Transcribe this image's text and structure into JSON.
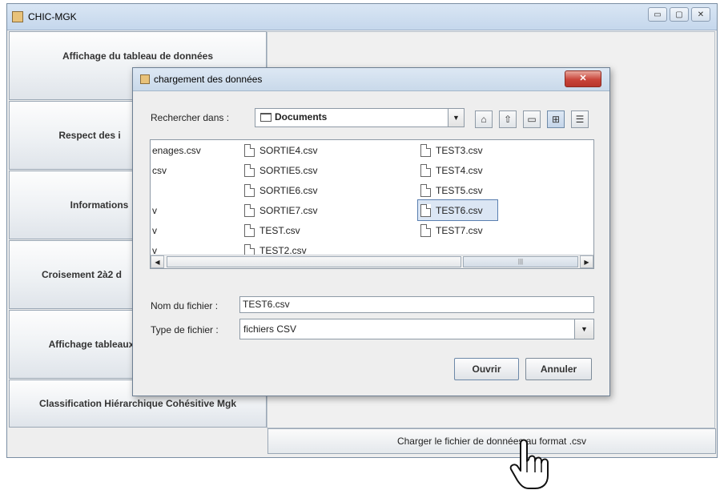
{
  "window": {
    "title": "CHIC-MGK",
    "controls": [
      "▭",
      "▢",
      "✕"
    ]
  },
  "sidebar": {
    "items": [
      {
        "label": "Affichage du tableau de données"
      },
      {
        "label": "Respect des i"
      },
      {
        "label": "Informations"
      },
      {
        "label": "Croisement 2à2 d"
      },
      {
        "label": "Affichage tableaux"
      },
      {
        "label": "Classification Hiérarchique Cohésitive Mgk"
      }
    ]
  },
  "main": {
    "load_button": "Charger le fichier de données au format .csv"
  },
  "dialog": {
    "title": "chargement des données",
    "close_label": "✕",
    "look_in_label": "Rechercher dans :",
    "look_in_value": "Documents",
    "file_name_label": "Nom du fichier :",
    "file_name_value": "TEST6.csv",
    "file_type_label": "Type de fichier :",
    "file_type_value": "fichiers CSV",
    "open_button": "Ouvrir",
    "cancel_button": "Annuler",
    "files_col0": [
      "enages.csv",
      "csv",
      "",
      "v",
      "v",
      "v"
    ],
    "files_col1": [
      "SORTIE4.csv",
      "SORTIE5.csv",
      "SORTIE6.csv",
      "SORTIE7.csv",
      "TEST.csv",
      "TEST2.csv"
    ],
    "files_col2": [
      "TEST3.csv",
      "TEST4.csv",
      "TEST5.csv",
      "TEST6.csv",
      "TEST7.csv"
    ],
    "selected_file": "TEST6.csv"
  },
  "colors": {
    "accent": "#5a7fb0",
    "close_red": "#c9453a"
  }
}
